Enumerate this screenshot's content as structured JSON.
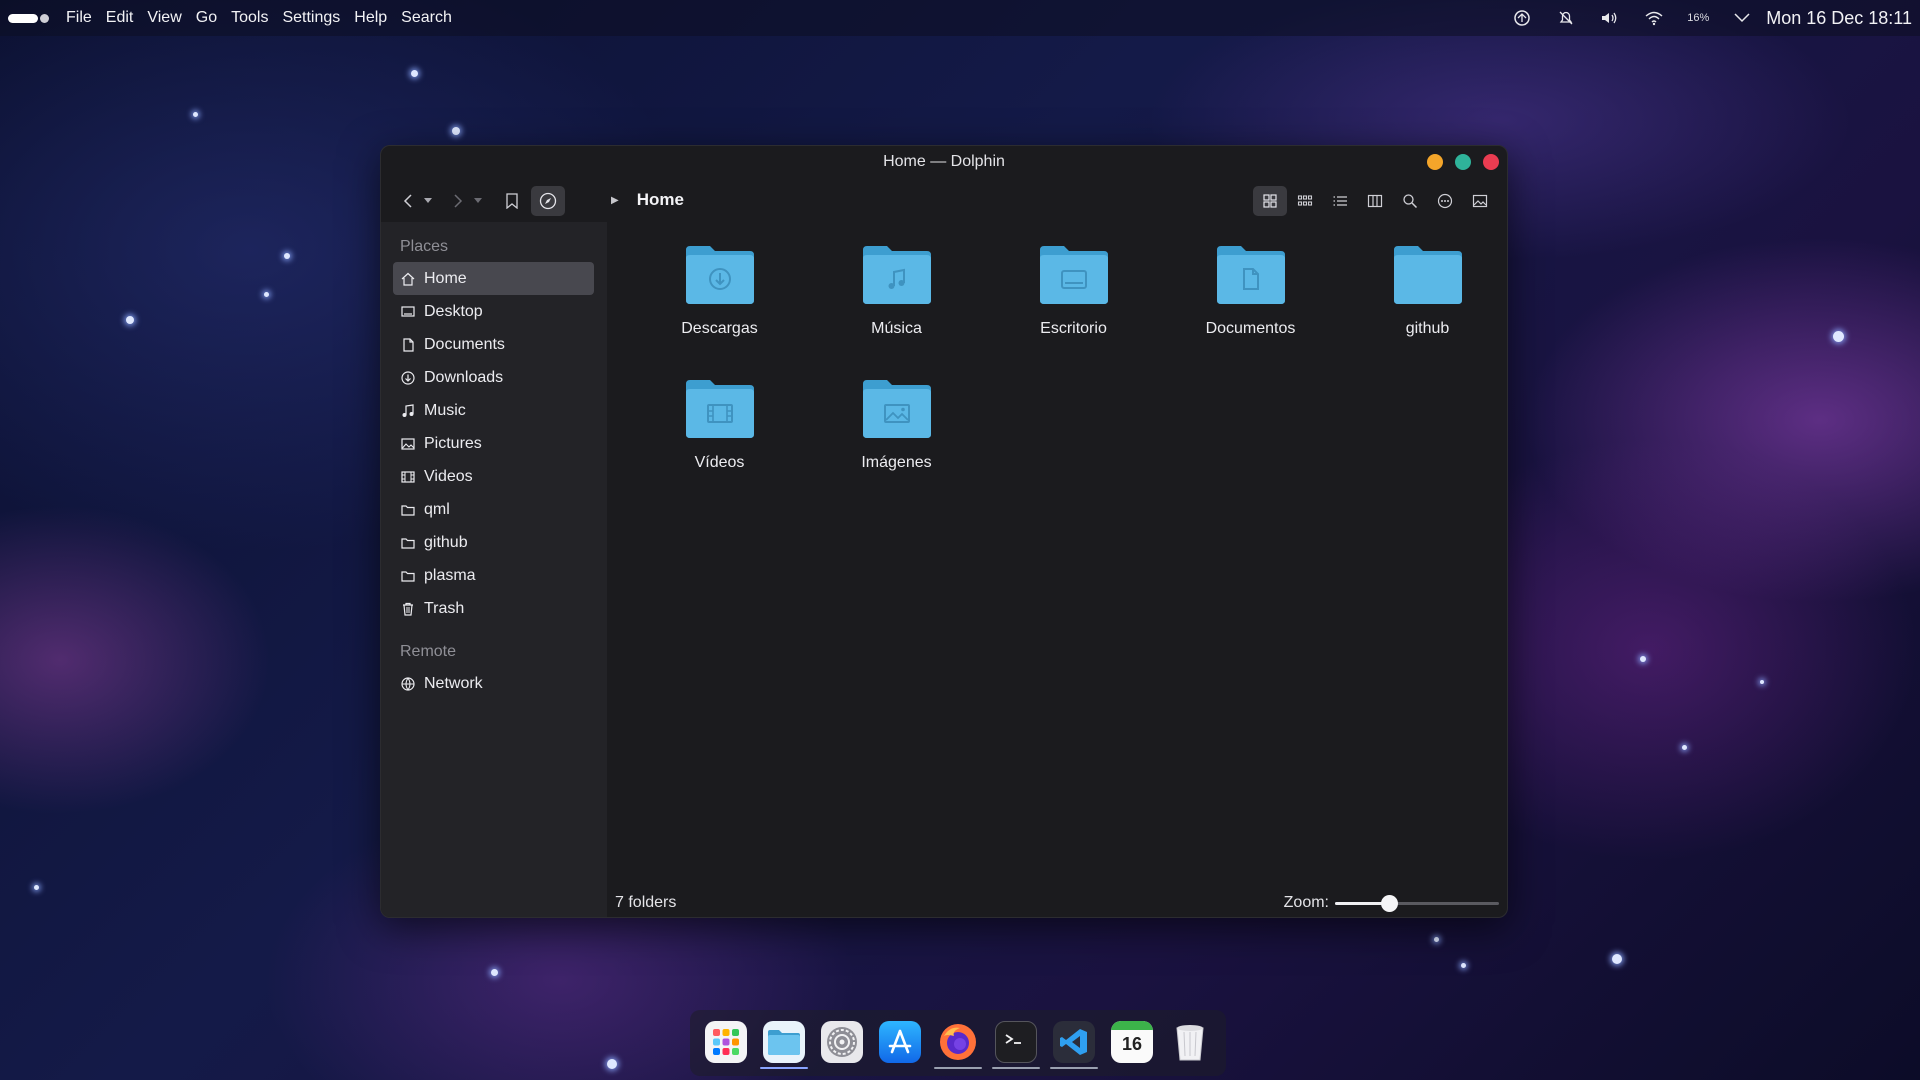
{
  "top_panel": {
    "menu": [
      "File",
      "Edit",
      "View",
      "Go",
      "Tools",
      "Settings",
      "Help",
      "Search"
    ],
    "tray": {
      "icons": [
        "updates-icon",
        "notifications-off-icon",
        "volume-icon",
        "wifi-icon"
      ],
      "battery": "16%",
      "clock": "Mon 16 Dec 18:11"
    }
  },
  "window": {
    "title": "Home — Dolphin",
    "buttons": {
      "minimize_color": "#f4a52a",
      "maximize_color": "#2fb39a",
      "close_color": "#ea3c51"
    },
    "breadcrumb": {
      "current": "Home"
    },
    "sidebar": {
      "places_title": "Places",
      "places": [
        {
          "label": "Home",
          "icon": "home-icon",
          "selected": true
        },
        {
          "label": "Desktop",
          "icon": "desktop-icon"
        },
        {
          "label": "Documents",
          "icon": "document-icon"
        },
        {
          "label": "Downloads",
          "icon": "download-icon"
        },
        {
          "label": "Music",
          "icon": "music-note-icon"
        },
        {
          "label": "Pictures",
          "icon": "picture-icon"
        },
        {
          "label": "Videos",
          "icon": "film-icon"
        },
        {
          "label": "qml",
          "icon": "folder-icon"
        },
        {
          "label": "github",
          "icon": "folder-icon"
        },
        {
          "label": "plasma",
          "icon": "folder-icon"
        },
        {
          "label": "Trash",
          "icon": "trash-icon"
        }
      ],
      "remote_title": "Remote",
      "remote": [
        {
          "label": "Network",
          "icon": "network-icon"
        }
      ]
    },
    "folders": [
      {
        "name": "Descargas",
        "emblem": "download"
      },
      {
        "name": "Música",
        "emblem": "music"
      },
      {
        "name": "Escritorio",
        "emblem": "desktop"
      },
      {
        "name": "Documentos",
        "emblem": "document"
      },
      {
        "name": "github",
        "emblem": "none"
      },
      {
        "name": "Vídeos",
        "emblem": "film"
      },
      {
        "name": "Imágenes",
        "emblem": "picture"
      }
    ],
    "status": {
      "count": "7 folders",
      "zoom_label": "Zoom:",
      "zoom_level": 0.33
    },
    "accent": "#5bb8e6"
  },
  "dock": {
    "apps": [
      {
        "name": "app-launcher",
        "running": false
      },
      {
        "name": "files",
        "running": true
      },
      {
        "name": "system-settings",
        "running": false
      },
      {
        "name": "app-store",
        "running": false
      },
      {
        "name": "firefox",
        "running": true
      },
      {
        "name": "terminal",
        "running": true
      },
      {
        "name": "vscode",
        "running": true
      },
      {
        "name": "calendar",
        "running": false,
        "label": "16"
      },
      {
        "name": "trash",
        "running": false
      }
    ]
  }
}
